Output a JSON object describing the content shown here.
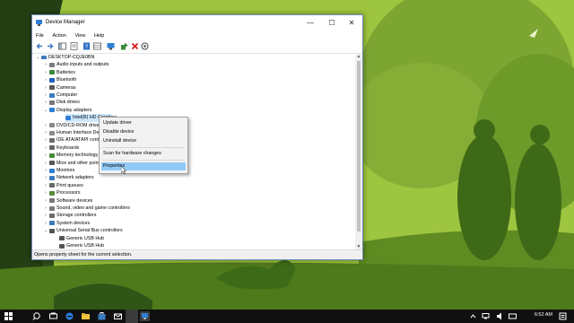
{
  "window": {
    "title": "Device Manager",
    "controls": {
      "minimize": "—",
      "maximize": "☐",
      "close": "✕"
    }
  },
  "menu": [
    "File",
    "Action",
    "View",
    "Help"
  ],
  "tree": {
    "root": "DESKTOP-CQJE0BN",
    "items": [
      {
        "label": "Audio inputs and outputs",
        "level": 1,
        "expander": "›",
        "icon": "speaker-icon",
        "color": "#7a7a7a"
      },
      {
        "label": "Batteries",
        "level": 1,
        "expander": "›",
        "icon": "battery-icon",
        "color": "#3a8b3a"
      },
      {
        "label": "Bluetooth",
        "level": 1,
        "expander": "›",
        "icon": "bluetooth-icon",
        "color": "#1f5fbf"
      },
      {
        "label": "Cameras",
        "level": 1,
        "expander": "›",
        "icon": "camera-icon",
        "color": "#555555"
      },
      {
        "label": "Computer",
        "level": 1,
        "expander": "›",
        "icon": "computer-icon",
        "color": "#3a7ac0"
      },
      {
        "label": "Disk drives",
        "level": 1,
        "expander": "›",
        "icon": "disk-icon",
        "color": "#777777"
      },
      {
        "label": "Display adapters",
        "level": 1,
        "expander": "⌄",
        "icon": "display-icon",
        "color": "#2f7fd6"
      },
      {
        "label": "Intel(R) HD Graphics",
        "level": 2,
        "expander": "",
        "icon": "display-icon",
        "color": "#2f7fd6",
        "selected": true
      },
      {
        "label": "DVD/CD-ROM drives",
        "level": 1,
        "expander": "›",
        "icon": "dvd-icon",
        "color": "#888888"
      },
      {
        "label": "Human Interface Devices",
        "level": 1,
        "expander": "›",
        "icon": "hid-icon",
        "color": "#8a8a8a"
      },
      {
        "label": "IDE ATA/ATAPI controllers",
        "level": 1,
        "expander": "›",
        "icon": "ide-icon",
        "color": "#6b6b6b"
      },
      {
        "label": "Keyboards",
        "level": 1,
        "expander": "›",
        "icon": "keyboard-icon",
        "color": "#666666"
      },
      {
        "label": "Memory technology devices",
        "level": 1,
        "expander": "›",
        "icon": "memory-icon",
        "color": "#4a8a3a"
      },
      {
        "label": "Mice and other pointing devices",
        "level": 1,
        "expander": "›",
        "icon": "mouse-icon",
        "color": "#555555"
      },
      {
        "label": "Monitors",
        "level": 1,
        "expander": "›",
        "icon": "monitor-icon",
        "color": "#2f7fd6"
      },
      {
        "label": "Network adapters",
        "level": 1,
        "expander": "›",
        "icon": "network-icon",
        "color": "#3a7ac0"
      },
      {
        "label": "Print queues",
        "level": 1,
        "expander": "›",
        "icon": "printer-icon",
        "color": "#666666"
      },
      {
        "label": "Processors",
        "level": 1,
        "expander": "›",
        "icon": "processor-icon",
        "color": "#5a8a3a"
      },
      {
        "label": "Software devices",
        "level": 1,
        "expander": "›",
        "icon": "software-icon",
        "color": "#777777"
      },
      {
        "label": "Sound, video and game controllers",
        "level": 1,
        "expander": "›",
        "icon": "sound-icon",
        "color": "#7a7a7a"
      },
      {
        "label": "Storage controllers",
        "level": 1,
        "expander": "›",
        "icon": "storage-icon",
        "color": "#6b6b6b"
      },
      {
        "label": "System devices",
        "level": 1,
        "expander": "›",
        "icon": "system-icon",
        "color": "#3a7ac0"
      },
      {
        "label": "Universal Serial Bus controllers",
        "level": 1,
        "expander": "⌄",
        "icon": "usb-icon",
        "color": "#555555"
      },
      {
        "label": "Generic USB Hub",
        "level": 2,
        "expander": "",
        "icon": "usb-icon",
        "color": "#555555"
      },
      {
        "label": "Generic USB Hub",
        "level": 2,
        "expander": "",
        "icon": "usb-icon",
        "color": "#555555"
      }
    ]
  },
  "context_menu": {
    "items": [
      {
        "label": "Update driver"
      },
      {
        "label": "Disable device"
      },
      {
        "label": "Uninstall device"
      },
      {
        "label": "Scan for hardware changes"
      },
      {
        "label": "Properties",
        "highlighted": true
      }
    ]
  },
  "status_bar": "Opens property sheet for the current selection.",
  "taskbar": {
    "time": "6:52 AM",
    "background": "#101010"
  },
  "colors": {
    "selection": "#cce8ff",
    "menu_highlight": "#91c9f7",
    "wallpaper_light": "#a3c94a",
    "wallpaper_dark": "#4f7a1c"
  }
}
